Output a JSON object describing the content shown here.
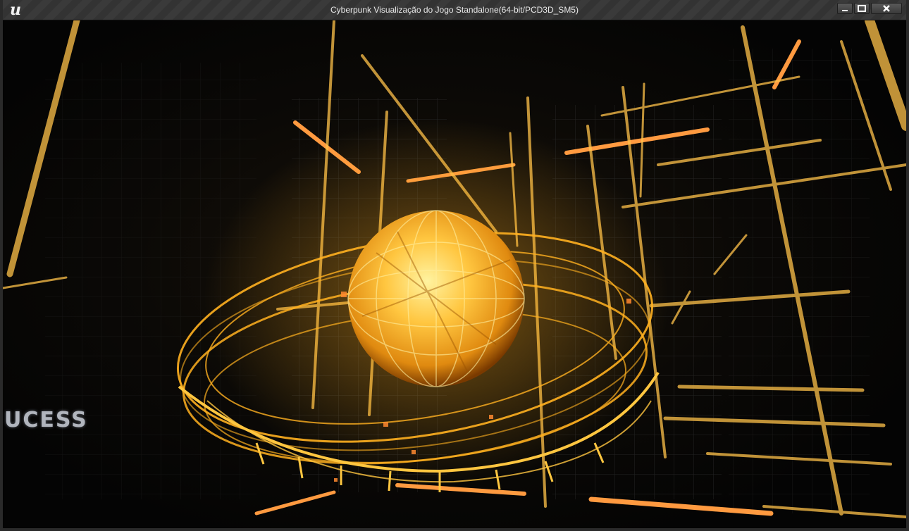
{
  "window": {
    "title": "Cyberpunk Visualização do Jogo Standalone(64-bit/PCD3D_SM5)",
    "logo_icon": "unreal-engine-logo-icon",
    "controls": [
      "minimize-icon",
      "maximize-icon",
      "close-icon"
    ]
  },
  "scene": {
    "overlay_text": "UCESS",
    "accent_color": "#ffb020",
    "glow_color": "#ffd24a"
  }
}
